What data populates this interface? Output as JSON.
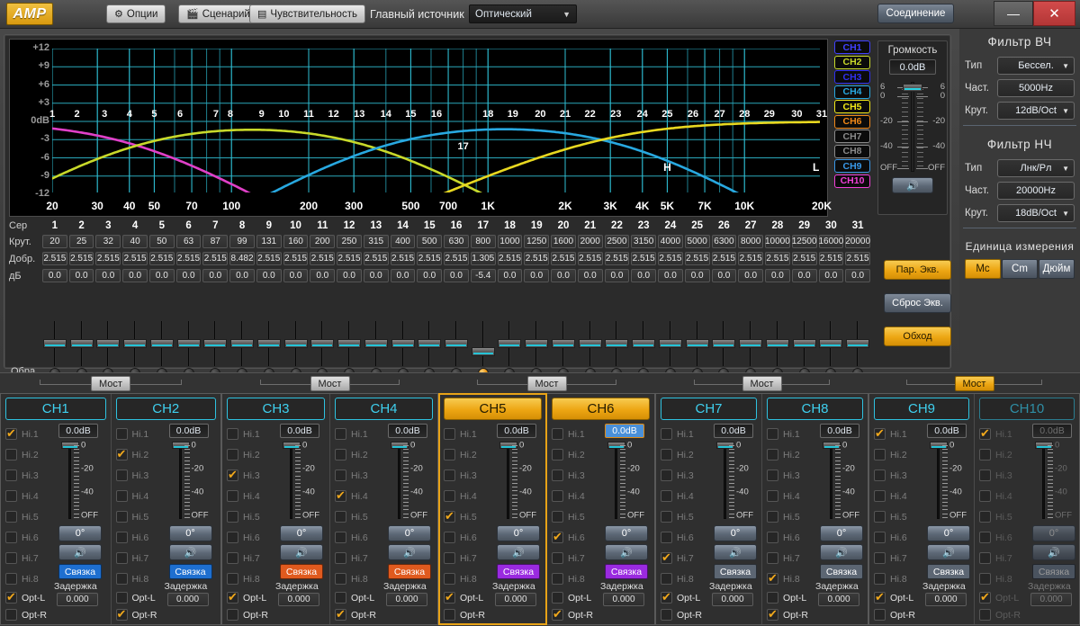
{
  "titlebar": {
    "logo": "AMP",
    "buttons": [
      {
        "icon": "gear-icon",
        "label": "Опции"
      },
      {
        "icon": "clapperboard-icon",
        "label": "Сценарий"
      },
      {
        "icon": "sliders-icon",
        "label": "Чувствительность"
      }
    ],
    "source_label": "Главный источник",
    "source_value": "Оптический",
    "connect_label": "Соединение",
    "minimize": "—",
    "close": "✕"
  },
  "chart_data": {
    "type": "line",
    "title": "",
    "xlabel": "",
    "ylabel": "dB",
    "grid": true,
    "xscale": "log",
    "xlim": [
      20,
      20000
    ],
    "ylim": [
      -12,
      12
    ],
    "ytick_labels": [
      "+12",
      "+9",
      "+6",
      "+3",
      "0dB",
      "-3",
      "-6",
      "-9",
      "-12"
    ],
    "ytick_values": [
      12,
      9,
      6,
      3,
      0,
      -3,
      -6,
      -9,
      -12
    ],
    "xtick_labels": [
      "20",
      "30",
      "40",
      "50",
      "70",
      "100",
      "200",
      "300",
      "500",
      "700",
      "1K",
      "2K",
      "3K",
      "4K",
      "5K",
      "7K",
      "10K",
      "20K"
    ],
    "xtick_values": [
      20,
      30,
      40,
      50,
      70,
      100,
      200,
      300,
      500,
      700,
      1000,
      2000,
      3000,
      4000,
      5000,
      7000,
      10000,
      20000
    ],
    "annotations": [
      {
        "text": "H",
        "x": 5000,
        "y": -7.5
      },
      {
        "text": "L",
        "x": 19000,
        "y": -7.5
      }
    ],
    "band_markers": {
      "note": "numbered EQ band markers plotted at band center frequency at its gain",
      "numbers": [
        1,
        2,
        3,
        4,
        5,
        6,
        7,
        8,
        9,
        10,
        11,
        12,
        13,
        14,
        15,
        16,
        17,
        18,
        19,
        20,
        21,
        22,
        23,
        24,
        25,
        26,
        27,
        28,
        29,
        30,
        31
      ],
      "freqs": [
        20,
        25,
        32,
        40,
        50,
        63,
        87,
        99,
        131,
        160,
        200,
        250,
        315,
        400,
        500,
        630,
        800,
        1000,
        1250,
        1600,
        2000,
        2500,
        3150,
        4000,
        5000,
        6300,
        8000,
        10000,
        12500,
        16000,
        20000
      ],
      "gains": [
        0,
        0,
        0,
        0,
        0,
        0,
        0,
        0,
        0,
        0,
        0,
        0,
        0,
        0,
        0,
        0,
        -5.4,
        0,
        0,
        0,
        0,
        0,
        0,
        0,
        0,
        0,
        0,
        0,
        0,
        0,
        0
      ]
    },
    "series": [
      {
        "name": "CH5 (magenta)",
        "color": "#e040c8",
        "shape": "lowpass-rolloff",
        "corner": 40,
        "slope_db_oct": 24
      },
      {
        "name": "CH2 (yellow-green)",
        "color": "#c8d92a",
        "shape": "bandpass",
        "low_corner": 45,
        "high_corner": 320
      },
      {
        "name": "CH4 (blue)",
        "color": "#28a8e0",
        "shape": "bandpass",
        "low_corner": 420,
        "high_corner": 3200
      },
      {
        "name": "CH9 (yellow)",
        "color": "#e8d820",
        "shape": "highpass",
        "corner": 3000,
        "slope_db_oct": 18
      }
    ]
  },
  "channel_legend": [
    {
      "label": "CH1",
      "color": "#4040ff",
      "active": true
    },
    {
      "label": "CH2",
      "color": "#c8d92a",
      "active": true
    },
    {
      "label": "CH3",
      "color": "#3030f0",
      "active": true
    },
    {
      "label": "CH4",
      "color": "#28a8e0",
      "active": true
    },
    {
      "label": "CH5",
      "color": "#f0e818",
      "active": true
    },
    {
      "label": "CH6",
      "color": "#f08818",
      "active": true
    },
    {
      "label": "CH7",
      "color": "#8a8a8a",
      "active": false
    },
    {
      "label": "CH8",
      "color": "#8a8a8a",
      "active": false
    },
    {
      "label": "CH9",
      "color": "#3898e8",
      "active": true
    },
    {
      "label": "CH10",
      "color": "#f040d8",
      "active": true
    }
  ],
  "volume": {
    "title": "Громкость",
    "value": "0.0dB",
    "ticks": [
      "6",
      "0",
      "-20",
      "-40",
      "OFF"
    ],
    "mute_icon": "speaker-icon"
  },
  "eq": {
    "row_labels": {
      "band": "Сер",
      "freq": "Крут.",
      "q": "Добр.",
      "gain": "дБ",
      "fader": "Обра"
    },
    "bands": [
      "1",
      "2",
      "3",
      "4",
      "5",
      "6",
      "7",
      "8",
      "9",
      "10",
      "11",
      "12",
      "13",
      "14",
      "15",
      "16",
      "17",
      "18",
      "19",
      "20",
      "21",
      "22",
      "23",
      "24",
      "25",
      "26",
      "27",
      "28",
      "29",
      "30",
      "31"
    ],
    "freq": [
      "20",
      "25",
      "32",
      "40",
      "50",
      "63",
      "87",
      "99",
      "131",
      "160",
      "200",
      "250",
      "315",
      "400",
      "500",
      "630",
      "800",
      "1000",
      "1250",
      "1600",
      "2000",
      "2500",
      "3150",
      "4000",
      "5000",
      "6300",
      "8000",
      "10000",
      "12500",
      "16000",
      "20000"
    ],
    "q": [
      "2.515",
      "2.515",
      "2.515",
      "2.515",
      "2.515",
      "2.515",
      "2.515",
      "8.482",
      "2.515",
      "2.515",
      "2.515",
      "2.515",
      "2.515",
      "2.515",
      "2.515",
      "2.515",
      "1.305",
      "2.515",
      "2.515",
      "2.515",
      "2.515",
      "2.515",
      "2.515",
      "2.515",
      "2.515",
      "2.515",
      "2.515",
      "2.515",
      "2.515",
      "2.515",
      "2.515"
    ],
    "gain": [
      "0.0",
      "0.0",
      "0.0",
      "0.0",
      "0.0",
      "0.0",
      "0.0",
      "0.0",
      "0.0",
      "0.0",
      "0.0",
      "0.0",
      "0.0",
      "0.0",
      "0.0",
      "0.0",
      "-5.4",
      "0.0",
      "0.0",
      "0.0",
      "0.0",
      "0.0",
      "0.0",
      "0.0",
      "0.0",
      "0.0",
      "0.0",
      "0.0",
      "0.0",
      "0.0",
      "0.0"
    ],
    "selected_band": 17,
    "buttons": {
      "par_eq": "Пар. Экв.",
      "reset_eq": "Сброс Экв.",
      "bypass": "Обход"
    }
  },
  "sidebar": {
    "hp": {
      "title": "Фильтр ВЧ",
      "type_label": "Тип",
      "type_value": "Бессел.",
      "freq_label": "Част.",
      "freq_value": "5000Hz",
      "slope_label": "Крут.",
      "slope_value": "12dB/Oct"
    },
    "lp": {
      "title": "Фильтр НЧ",
      "type_label": "Тип",
      "type_value": "Лнк/Рл",
      "freq_label": "Част.",
      "freq_value": "20000Hz",
      "slope_label": "Крут.",
      "slope_value": "18dB/Oct"
    },
    "units": {
      "title": "Единица измерения",
      "options": [
        "Mc",
        "Cm",
        "Дюйм"
      ],
      "selected": "Mc"
    }
  },
  "channels": {
    "bridge_label": "Мост",
    "hi_labels": [
      "Hi.1",
      "Hi.2",
      "Hi.3",
      "Hi.4",
      "Hi.5",
      "Hi.6",
      "Hi.7",
      "Hi.8"
    ],
    "opt_l": "Opt-L",
    "opt_r": "Opt-R",
    "phase_label": "0°",
    "link_label": "Связка",
    "delay_label": "Задержка",
    "mute_icon": "speaker-icon",
    "fader_ticks": [
      "0",
      "-20",
      "-40",
      "OFF"
    ],
    "pairs": [
      {
        "bridge_active": false,
        "strips": [
          {
            "name": "CH1",
            "selected": false,
            "header_on": false,
            "dimmed": false,
            "db": "0.0dB",
            "db_edit": false,
            "hi_checked": [
              true,
              false,
              false,
              false,
              false,
              false,
              false,
              false
            ],
            "opt_l": true,
            "opt_r": false,
            "phase": "0°",
            "link": "Связка",
            "link_color": "#1e6fd0",
            "delay": "0.000"
          },
          {
            "name": "CH2",
            "selected": false,
            "header_on": false,
            "dimmed": false,
            "db": "0.0dB",
            "db_edit": false,
            "hi_checked": [
              false,
              true,
              false,
              false,
              false,
              false,
              false,
              false
            ],
            "opt_l": false,
            "opt_r": true,
            "phase": "0°",
            "link": "Связка",
            "link_color": "#1e6fd0",
            "delay": "0.000"
          }
        ]
      },
      {
        "bridge_active": false,
        "strips": [
          {
            "name": "CH3",
            "selected": false,
            "header_on": false,
            "dimmed": false,
            "db": "0.0dB",
            "db_edit": false,
            "hi_checked": [
              false,
              false,
              true,
              false,
              false,
              false,
              false,
              false
            ],
            "opt_l": true,
            "opt_r": false,
            "phase": "0°",
            "link": "Связка",
            "link_color": "#e05a1e",
            "delay": "0.000"
          },
          {
            "name": "CH4",
            "selected": false,
            "header_on": false,
            "dimmed": false,
            "db": "0.0dB",
            "db_edit": false,
            "hi_checked": [
              false,
              false,
              false,
              true,
              false,
              false,
              false,
              false
            ],
            "opt_l": false,
            "opt_r": true,
            "phase": "0°",
            "link": "Связка",
            "link_color": "#e05a1e",
            "delay": "0.000"
          }
        ]
      },
      {
        "bridge_active": false,
        "strips": [
          {
            "name": "CH5",
            "selected": true,
            "header_on": true,
            "dimmed": false,
            "db": "0.0dB",
            "db_edit": false,
            "hi_checked": [
              false,
              false,
              false,
              false,
              true,
              false,
              false,
              false
            ],
            "opt_l": true,
            "opt_r": false,
            "phase": "0°",
            "link": "Связка",
            "link_color": "#9a2ae0",
            "delay": "0.000"
          },
          {
            "name": "CH6",
            "selected": false,
            "header_on": true,
            "dimmed": false,
            "db": "0.0dB",
            "db_edit": true,
            "hi_checked": [
              false,
              false,
              false,
              false,
              false,
              true,
              false,
              false
            ],
            "opt_l": false,
            "opt_r": true,
            "phase": "0°",
            "link": "Связка",
            "link_color": "#9a2ae0",
            "delay": "0.000"
          }
        ]
      },
      {
        "bridge_active": false,
        "strips": [
          {
            "name": "CH7",
            "selected": false,
            "header_on": false,
            "dimmed": false,
            "db": "0.0dB",
            "db_edit": false,
            "hi_checked": [
              false,
              false,
              false,
              false,
              false,
              false,
              true,
              false
            ],
            "opt_l": true,
            "opt_r": false,
            "phase": "0°",
            "link": "Связка",
            "link_color": "#5c6673"
          },
          {
            "name": "CH8",
            "selected": false,
            "header_on": false,
            "dimmed": false,
            "db": "0.0dB",
            "db_edit": false,
            "hi_checked": [
              false,
              false,
              false,
              false,
              false,
              false,
              false,
              true
            ],
            "opt_l": false,
            "opt_r": true,
            "phase": "0°",
            "link": "Связка",
            "link_color": "#5c6673",
            "delay": "0.000"
          }
        ]
      },
      {
        "bridge_active": true,
        "strips": [
          {
            "name": "CH9",
            "selected": false,
            "header_on": false,
            "dimmed": false,
            "db": "0.0dB",
            "db_edit": false,
            "hi_checked": [
              true,
              false,
              false,
              false,
              false,
              false,
              false,
              false
            ],
            "opt_l": true,
            "opt_r": false,
            "phase": "0°",
            "link": "Связка",
            "link_color": "#5c6673",
            "delay": "0.000"
          },
          {
            "name": "CH10",
            "selected": false,
            "header_on": false,
            "dimmed": true,
            "db": "0.0dB",
            "db_edit": false,
            "hi_checked": [
              true,
              false,
              false,
              false,
              false,
              false,
              false,
              false
            ],
            "opt_l": true,
            "opt_r": false,
            "phase": "0°",
            "link": "Связка",
            "link_color": "#4a535f",
            "delay": "0.000"
          }
        ]
      }
    ]
  }
}
